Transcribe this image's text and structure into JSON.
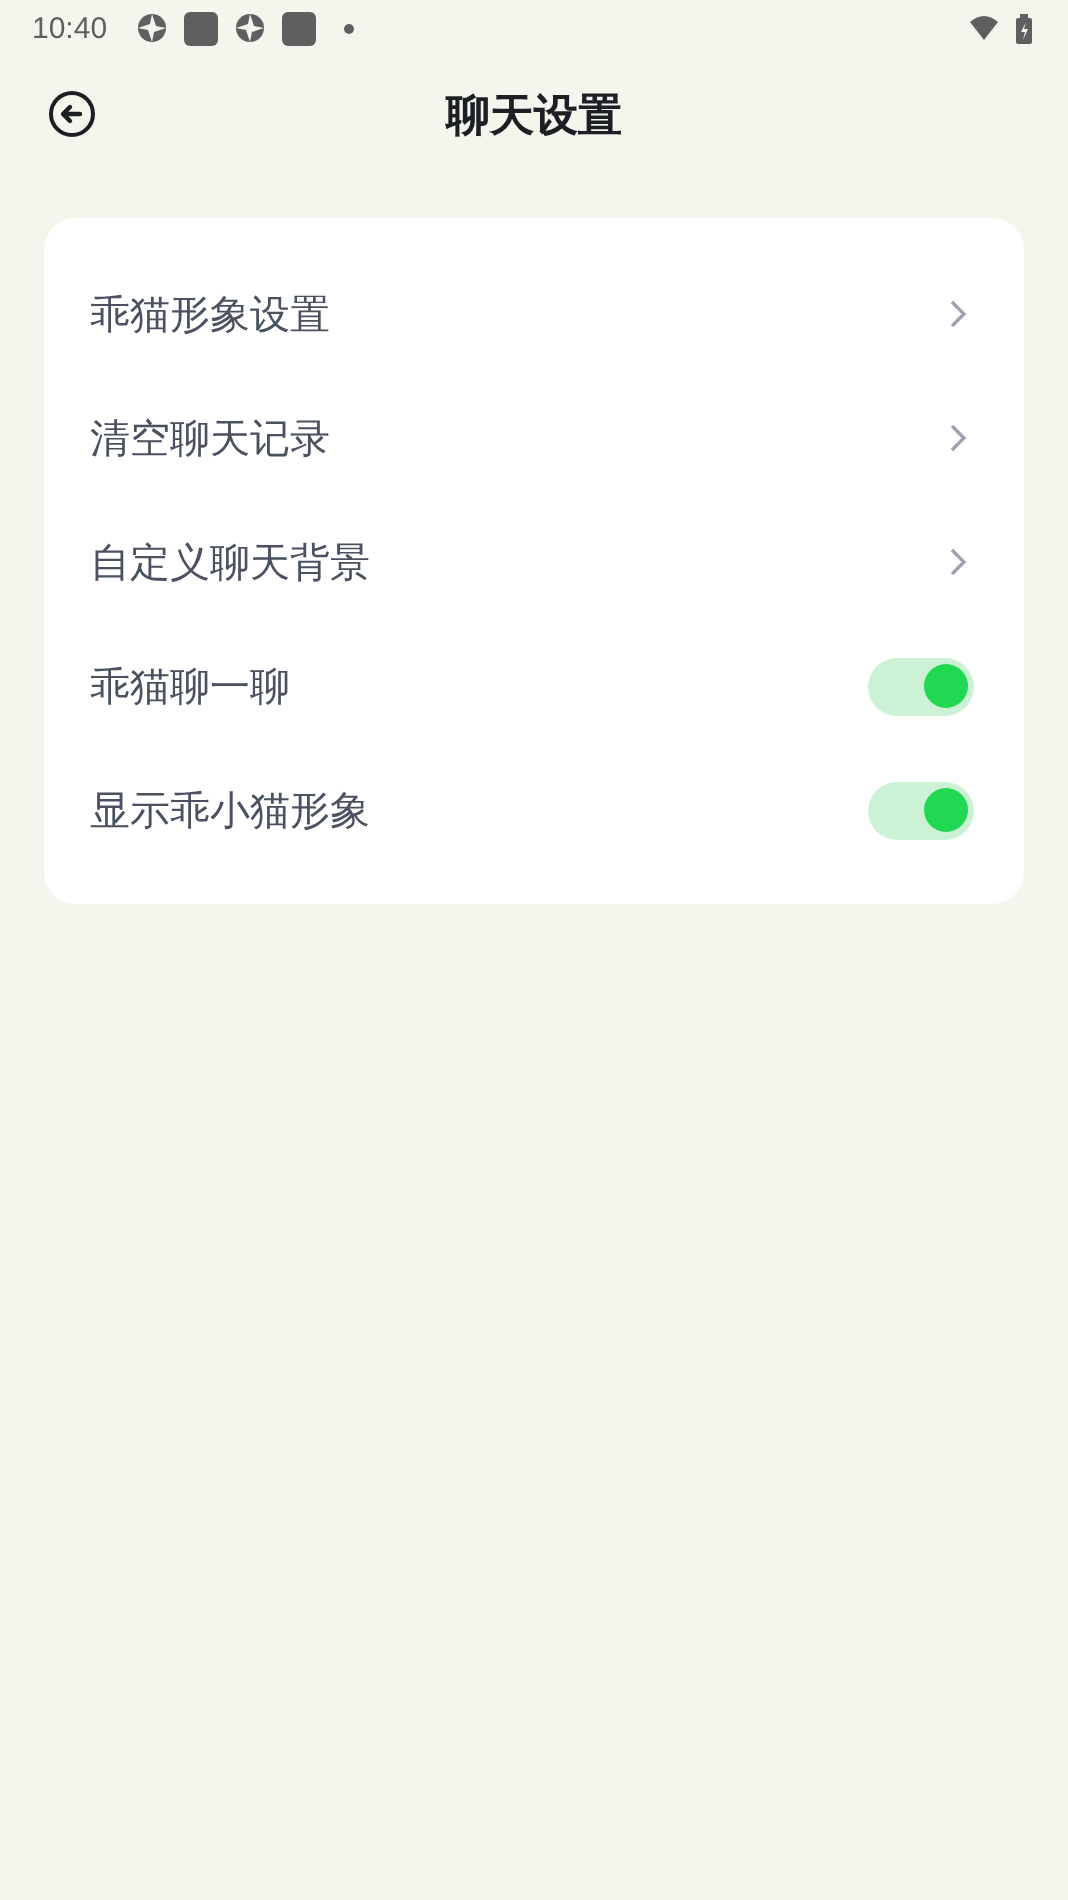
{
  "status_bar": {
    "time": "10:40"
  },
  "header": {
    "title": "聊天设置"
  },
  "settings": [
    {
      "kind": "link",
      "label": "乖猫形象设置"
    },
    {
      "kind": "link",
      "label": "清空聊天记录"
    },
    {
      "kind": "link",
      "label": "自定义聊天背景"
    },
    {
      "kind": "toggle",
      "label": "乖猫聊一聊",
      "on": true
    },
    {
      "kind": "toggle",
      "label": "显示乖小猫形象",
      "on": true
    }
  ]
}
